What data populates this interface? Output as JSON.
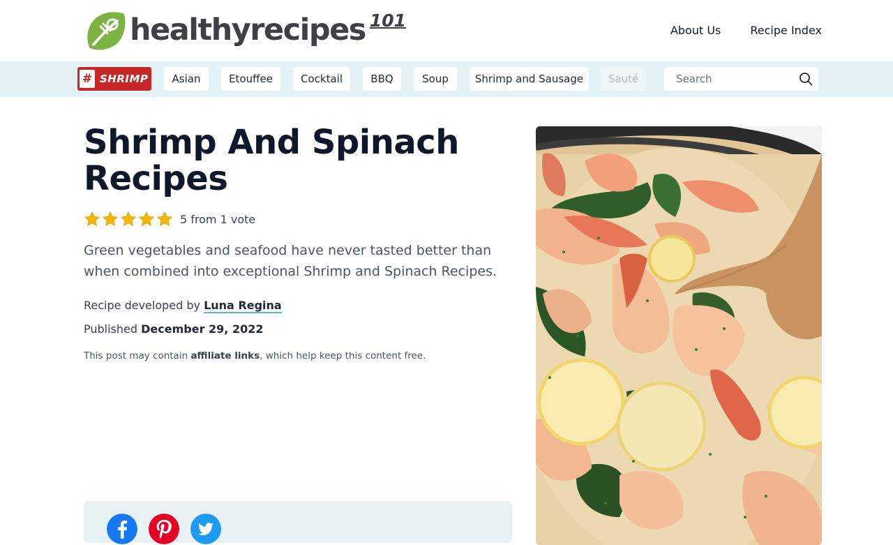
{
  "header": {
    "logo_text": "healthyrecipes",
    "logo_sup": "101",
    "nav": [
      {
        "label": "About Us"
      },
      {
        "label": "Recipe Index"
      }
    ]
  },
  "tagbar": {
    "badge_hash": "#",
    "badge_label": "SHRIMP",
    "chips": [
      {
        "label": "Asian"
      },
      {
        "label": "Etouffee"
      },
      {
        "label": "Cocktail"
      },
      {
        "label": "BBQ"
      },
      {
        "label": "Soup"
      },
      {
        "label": "Shrimp and Sausage"
      },
      {
        "label": "Sauté"
      }
    ],
    "search": {
      "placeholder": "Search",
      "value": ""
    }
  },
  "article": {
    "title": "Shrimp And Spinach Recipes",
    "rating": {
      "stars": 5,
      "max": 5,
      "text": "5 from 1 vote"
    },
    "lead": "Green vegetables and seafood have never tasted better than when combined into exceptional Shrimp and Spinach Recipes.",
    "byline_prefix": "Recipe developed by",
    "author": "Luna Regina",
    "published_prefix": "Published",
    "published_date": "December 29, 2022",
    "affiliate_prefix": "This post may contain",
    "affiliate_link": "affiliate links",
    "affiliate_suffix": ", which help keep this content free."
  },
  "share": [
    {
      "icon": "facebook-icon",
      "color": "#1877f2"
    },
    {
      "icon": "pinterest-icon",
      "color": "#e60023"
    },
    {
      "icon": "twitter-icon",
      "color": "#1d9bf0"
    }
  ],
  "colors": {
    "brand_green": "#7cb342",
    "tagbar_bg": "#e3f2f6",
    "badge_red": "#c62828",
    "star_yellow": "#f5b800",
    "link_underline": "#5eb8c9"
  }
}
